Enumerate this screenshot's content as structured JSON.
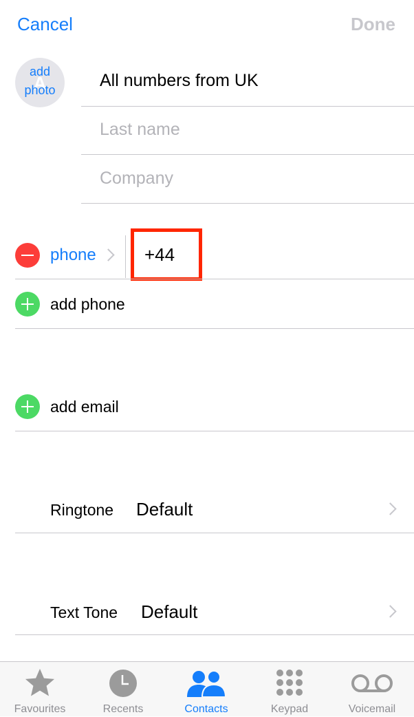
{
  "nav": {
    "cancel": "Cancel",
    "done": "Done"
  },
  "photo": {
    "line1": "add",
    "line2": "photo",
    "initial": "A"
  },
  "fields": {
    "first_name": "All numbers from UK",
    "last_name_placeholder": "Last name",
    "company_placeholder": "Company"
  },
  "phone": {
    "label": "phone",
    "value": "+44",
    "highlight_color": "#ff2600"
  },
  "add_phone": "add phone",
  "add_email": "add email",
  "ringtone": {
    "label": "Ringtone",
    "value": "Default"
  },
  "text_tone": {
    "label": "Text Tone",
    "value": "Default"
  },
  "tabs": [
    {
      "label": "Favourites",
      "icon": "star-icon"
    },
    {
      "label": "Recents",
      "icon": "clock-icon"
    },
    {
      "label": "Contacts",
      "icon": "contacts-icon",
      "active": true
    },
    {
      "label": "Keypad",
      "icon": "keypad-icon"
    },
    {
      "label": "Voicemail",
      "icon": "voicemail-icon"
    }
  ],
  "colors": {
    "accent": "#157efb",
    "delete": "#fc3d39",
    "add": "#4cd964"
  }
}
